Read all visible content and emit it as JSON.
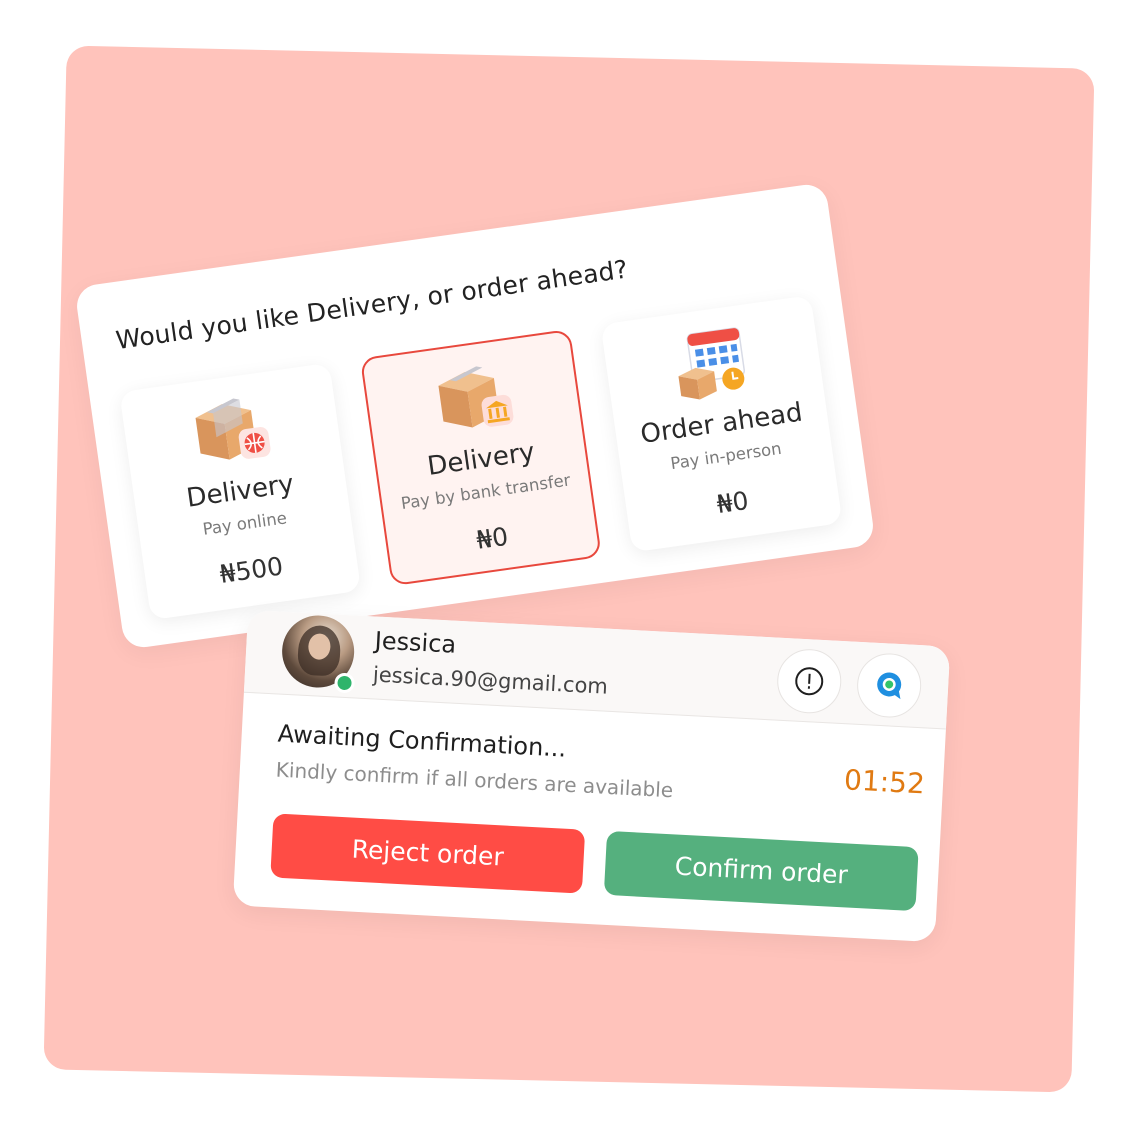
{
  "options": {
    "question": "Would you like Delivery, or order ahead?",
    "items": [
      {
        "icon": "box-globe-icon",
        "name": "Delivery",
        "sub": "Pay online",
        "price": "₦500",
        "selected": false
      },
      {
        "icon": "box-bank-icon",
        "name": "Delivery",
        "sub": "Pay by bank transfer",
        "price": "₦0",
        "selected": true
      },
      {
        "icon": "calendar-box-icon",
        "name": "Order ahead",
        "sub": "Pay in-person",
        "price": "₦0",
        "selected": false
      }
    ]
  },
  "order": {
    "user": {
      "name": "Jessica",
      "email": "jessica.90@gmail.com",
      "online": true
    },
    "status_title": "Awaiting Confirmation...",
    "status_sub": "Kindly confirm if all orders are available",
    "timer": "01:52",
    "reject_label": "Reject order",
    "confirm_label": "Confirm order"
  },
  "colors": {
    "background": "#ffc3bb",
    "selected_border": "#e8483d",
    "reject": "#ff4c45",
    "confirm": "#55b07e",
    "timer": "#e07a12",
    "online": "#2fb46b"
  }
}
